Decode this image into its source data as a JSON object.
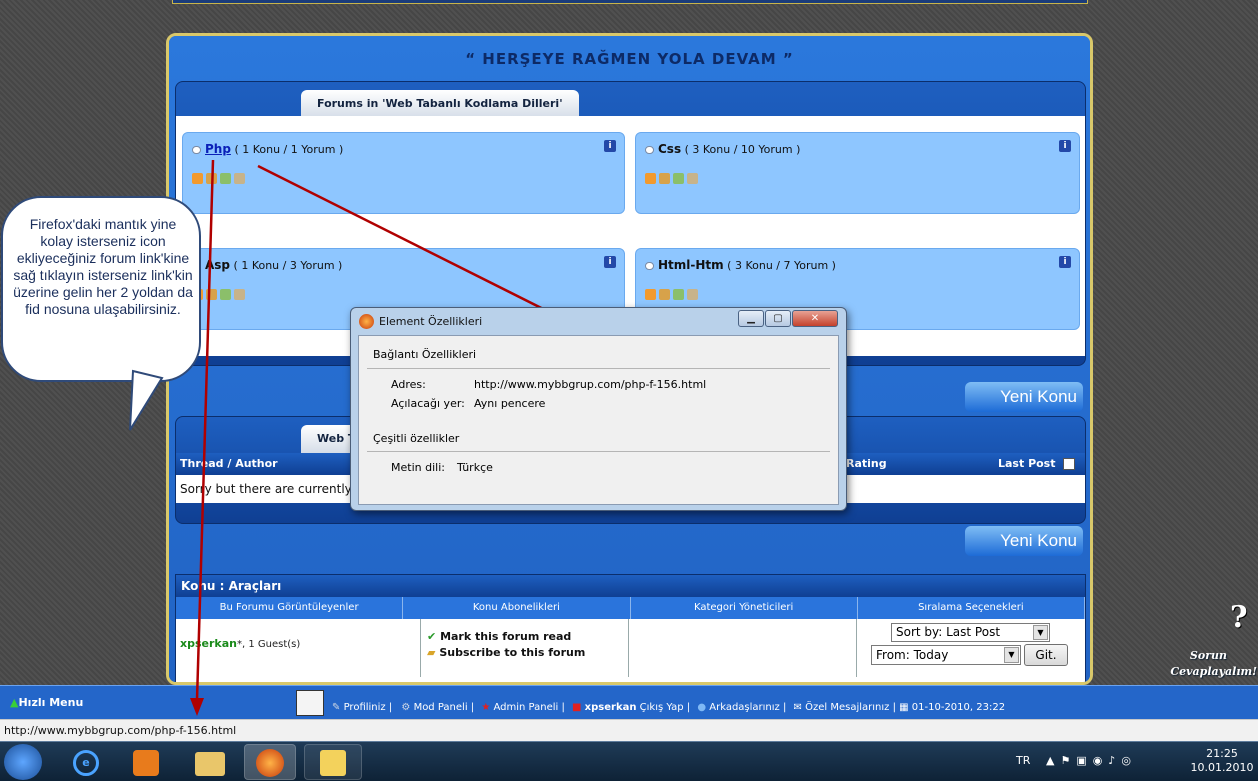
{
  "site": {
    "title": "“ HERŞEYE  RAĞMEN  YOLA  DEVAM ”"
  },
  "forums_section": {
    "header": "Forums in 'Web Tabanlı Kodlama Dilleri'",
    "forums": [
      {
        "name": "Php",
        "stats": "( 1 Konu / 1 Yorum )",
        "is_link": true
      },
      {
        "name": "Css",
        "stats": "( 3 Konu / 10 Yorum )",
        "is_link": false
      },
      {
        "name": "Asp",
        "stats": "( 1 Konu / 3 Yorum )",
        "is_link": false
      },
      {
        "name": "Html-Htm",
        "stats": "( 3 Konu / 7 Yorum )",
        "is_link": false
      }
    ]
  },
  "new_thread_label": "Yeni Konu",
  "threads_section": {
    "tab_label": "Web T",
    "col_thread": "Thread / Author",
    "col_rating": "Rating",
    "col_lastpost": "Last Post",
    "empty_message": "Sorry but there are currently no"
  },
  "tools": {
    "header": "Konu : Araçları",
    "columns": [
      "Bu Forumu Görüntüleyenler",
      "Konu Abonelikleri",
      "Kategori Yöneticileri",
      "Sıralama Seçenekleri"
    ],
    "viewer_user": "xpserkan",
    "viewer_suffix": "*, 1 Guest(s)",
    "mark_read": "Mark this forum read",
    "subscribe": "Subscribe to this forum",
    "sort_by_value": "Sort by: Last Post",
    "from_value": "From: Today",
    "go_label": "Git."
  },
  "bottom_bar": {
    "quick_menu": "Hızlı Menu",
    "profile": "Profiliniz |",
    "mod_panel": "Mod Paneli |",
    "admin_panel": "Admin Paneli |",
    "username": "xpserkan",
    "logout": "Çıkış Yap |",
    "friends": "Arkadaşlarınız |",
    "messages": "Özel Mesajlarınız |",
    "datetime": "01-10-2010, 23:22"
  },
  "status_url": "http://www.mybbgrup.com/php-f-156.html",
  "dialog": {
    "title": "Element Özellikleri",
    "link_props": "Bağlantı Özellikleri",
    "address_label": "Adres:",
    "address_value": "http://www.mybbgrup.com/php-f-156.html",
    "open_label": "Açılacağı yer:",
    "open_value": "Aynı pencere",
    "misc_props": "Çeşitli özellikler",
    "lang_label": "Metin dili:",
    "lang_value": "Türkçe"
  },
  "callout_text": "Firefox'daki mantık yine kolay isterseniz icon ekliyeceğiniz forum link'kine sağ tıklayın isterseniz link'kin üzerine gelin her 2 yoldan da fid nosuna ulaşabilirsiniz.",
  "help_badge": {
    "line1": "Sorun",
    "line2": "Cevaplayalım!"
  },
  "taskbar": {
    "lang": "TR",
    "time": "21:25",
    "date": "10.01.2010"
  }
}
